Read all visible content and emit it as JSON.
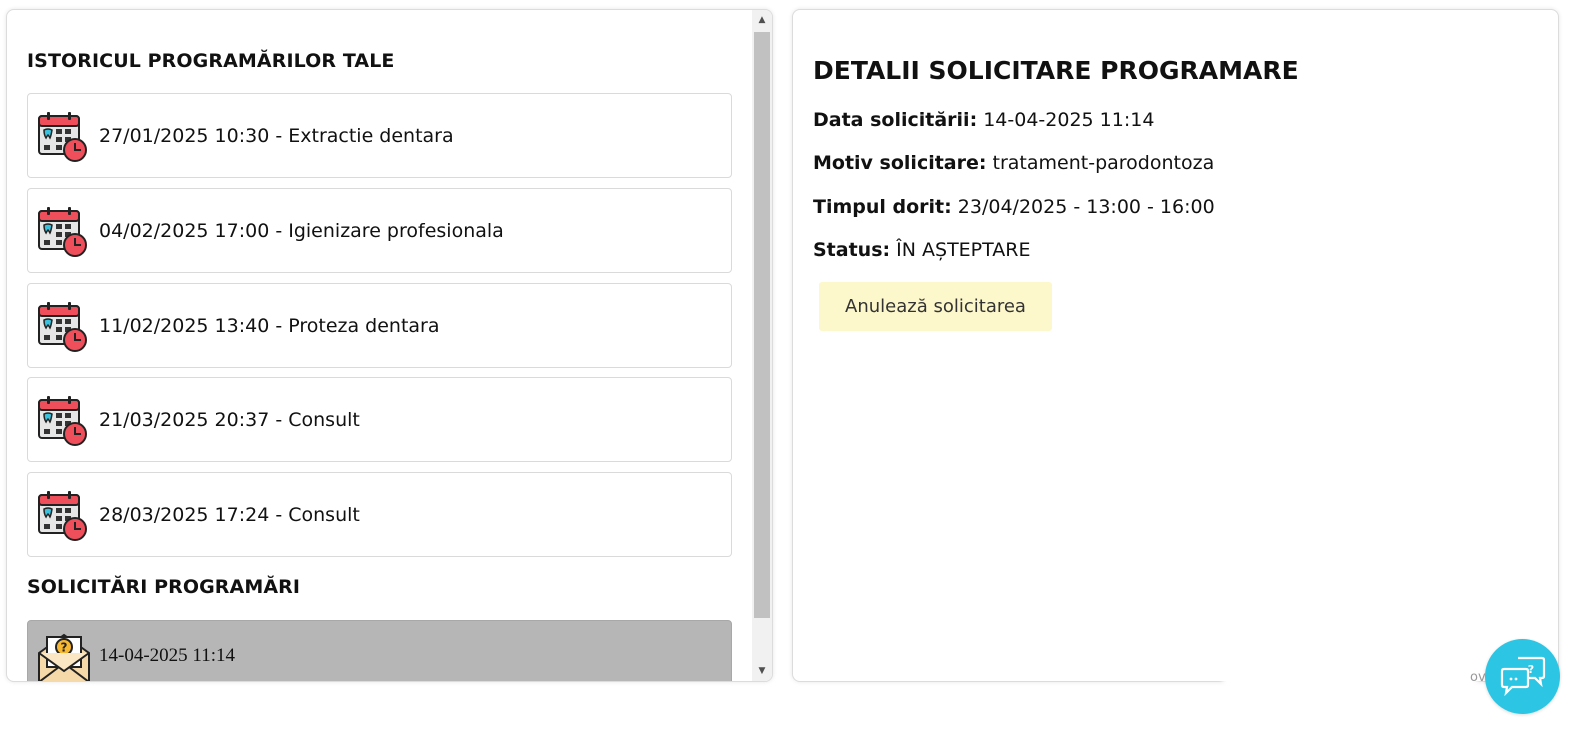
{
  "history": {
    "title": "ISTORICUL PROGRAMĂRILOR TALE",
    "items": [
      {
        "label": "27/01/2025 10:30 - Extractie dentara",
        "icon": "dental-calendar-icon"
      },
      {
        "label": "04/02/2025 17:00 - Igienizare profesionala",
        "icon": "dental-calendar-icon"
      },
      {
        "label": "11/02/2025 13:40 - Proteza dentara",
        "icon": "dental-calendar-icon"
      },
      {
        "label": "21/03/2025 20:37 - Consult",
        "icon": "dental-calendar-icon"
      },
      {
        "label": "28/03/2025 17:24 - Consult",
        "icon": "dental-calendar-icon"
      }
    ]
  },
  "requests": {
    "title": "SOLICITĂRI PROGRAMĂRI",
    "items": [
      {
        "label": "14-04-2025 11:14",
        "icon": "envelope-question-icon",
        "selected": true
      }
    ]
  },
  "details": {
    "title": "DETALII SOLICITARE PROGRAMARE",
    "date_label": "Data solicitării:",
    "date_value": "14-04-2025 11:14",
    "reason_label": "Motiv solicitare:",
    "reason_value": "tratament-parodontoza",
    "time_label": "Timpul dorit:",
    "time_value": "23/04/2025 - 13:00 - 16:00",
    "status_label": "Status:",
    "status_value": "ÎN AȘTEPTARE",
    "cancel_label": "Anulează solicitarea"
  },
  "footer": {
    "trail_text": "ove"
  },
  "chat": {
    "icon": "chat-help-icon"
  },
  "colors": {
    "cancel_button_bg": "#fdf8cc",
    "selected_request_bg": "#b6b6b6",
    "chat_button_bg": "#2cc5e3",
    "calendar_red": "#ef4f5b"
  }
}
